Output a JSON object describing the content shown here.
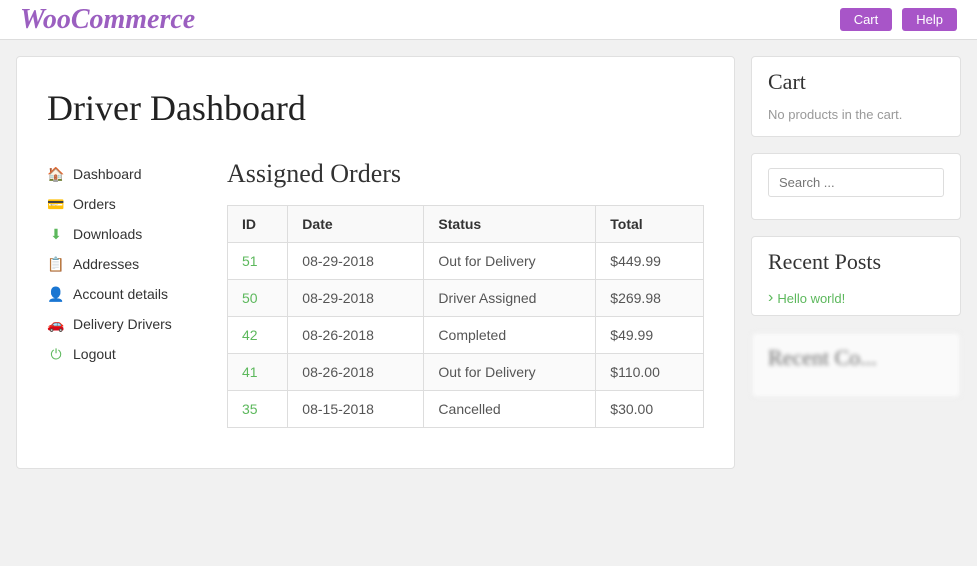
{
  "header": {
    "logo": "WooCommerce",
    "button1": "Cart",
    "button2": "Help"
  },
  "page": {
    "title": "Driver Dashboard"
  },
  "nav": {
    "items": [
      {
        "label": "Dashboard",
        "icon": "🏠",
        "href": "#"
      },
      {
        "label": "Orders",
        "icon": "💳",
        "href": "#"
      },
      {
        "label": "Downloads",
        "icon": "⬇",
        "href": "#"
      },
      {
        "label": "Addresses",
        "icon": "📋",
        "href": "#"
      },
      {
        "label": "Account details",
        "icon": "👤",
        "href": "#"
      },
      {
        "label": "Delivery Drivers",
        "icon": "🚗",
        "href": "#"
      },
      {
        "label": "Logout",
        "icon": "⏻",
        "href": "#"
      }
    ]
  },
  "orders": {
    "section_title": "Assigned Orders",
    "columns": [
      "ID",
      "Date",
      "Status",
      "Total"
    ],
    "rows": [
      {
        "id": "51",
        "date": "08-29-2018",
        "status": "Out for Delivery",
        "total": "$449.99"
      },
      {
        "id": "50",
        "date": "08-29-2018",
        "status": "Driver Assigned",
        "total": "$269.98"
      },
      {
        "id": "42",
        "date": "08-26-2018",
        "status": "Completed",
        "total": "$49.99"
      },
      {
        "id": "41",
        "date": "08-26-2018",
        "status": "Out for Delivery",
        "total": "$110.00"
      },
      {
        "id": "35",
        "date": "08-15-2018",
        "status": "Cancelled",
        "total": "$30.00"
      }
    ]
  },
  "sidebar": {
    "cart": {
      "title": "Cart",
      "empty_text": "No products in the cart."
    },
    "search": {
      "placeholder": "Search ..."
    },
    "recent_posts": {
      "title": "Recent Posts",
      "links": [
        {
          "label": "Hello world!"
        }
      ]
    },
    "blurred_widget_title": "Recent Co..."
  }
}
